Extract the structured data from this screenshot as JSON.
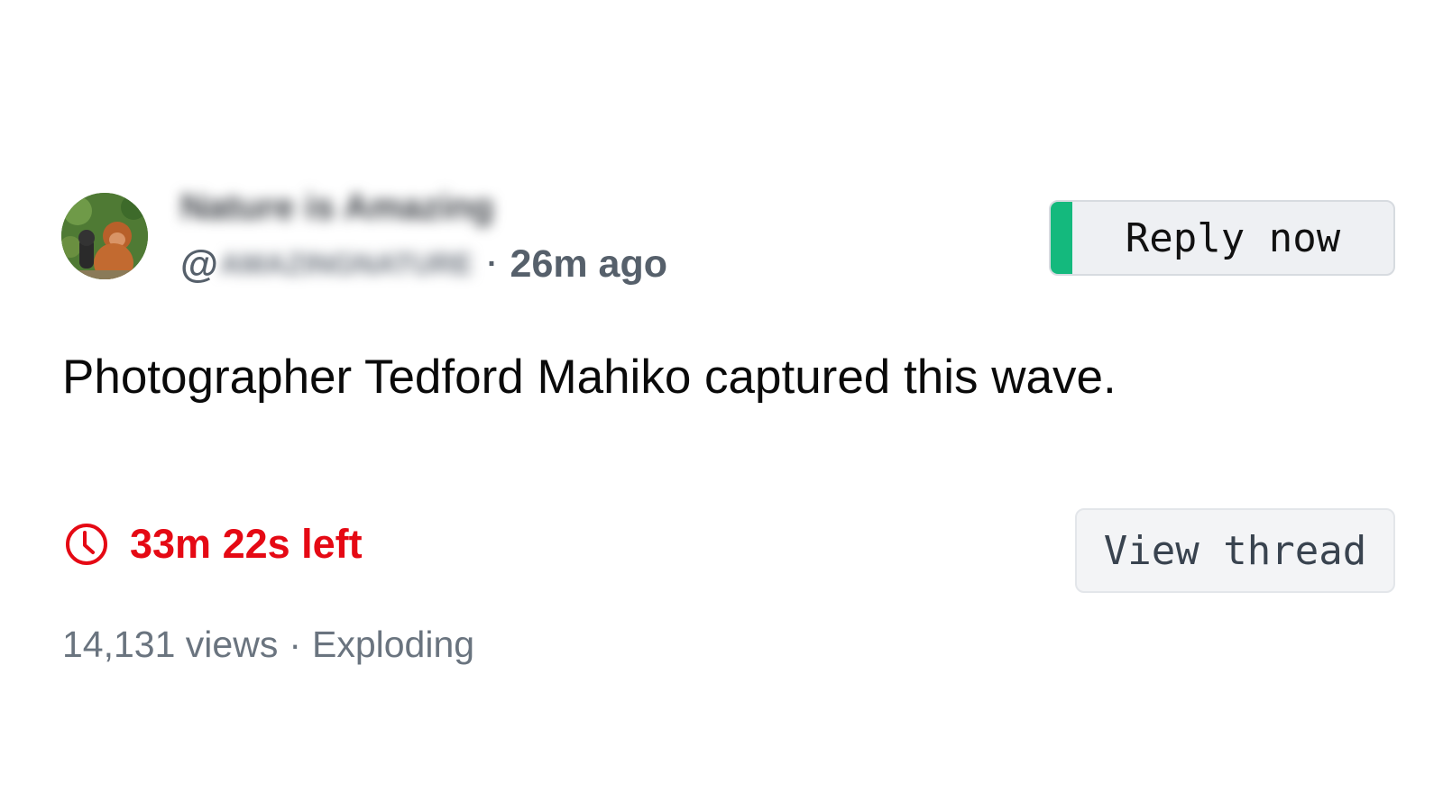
{
  "author": {
    "display_name": "Nature is Amazing",
    "handle_prefix": "@",
    "handle": "AMAZINGNATURE",
    "separator": "·",
    "posted_ago": "26m ago"
  },
  "actions": {
    "reply_label": "Reply now",
    "reply_accent_color": "#14b97d",
    "view_thread_label": "View thread"
  },
  "post": {
    "text": "Photographer Tedford Mahiko captured this wave."
  },
  "timer": {
    "icon": "clock-icon",
    "label": "33m 22s left",
    "color": "#e50914"
  },
  "stats": {
    "views": "14,131 views",
    "separator": "·",
    "status": "Exploding"
  }
}
